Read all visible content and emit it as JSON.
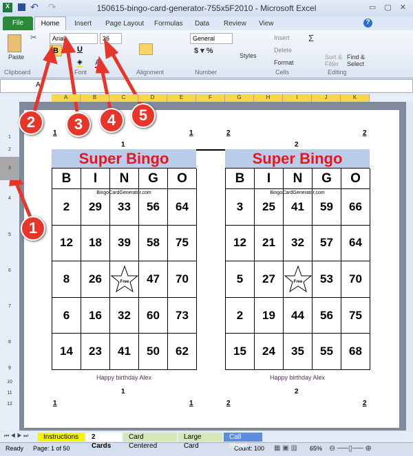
{
  "window": {
    "title": "150615-bingo-card-generator-755x5F2010 - Microsoft Excel"
  },
  "ribbon_tabs": [
    "File",
    "Home",
    "Insert",
    "Page Layout",
    "Formulas",
    "Data",
    "Review",
    "View"
  ],
  "ribbon": {
    "paste": "Paste",
    "font_name": "Arial",
    "font_size": "36",
    "bold": "B",
    "underline": "U",
    "number_format": "General",
    "styles": "Styles",
    "insert": "Insert",
    "delete": "Delete",
    "format": "Format",
    "sort_filter": "Sort & Filter",
    "find_select": "Find & Select",
    "groups": [
      "Clipboard",
      "Font",
      "Alignment",
      "Number",
      "Cells",
      "Editing"
    ]
  },
  "formula_bar": {
    "name_box": "A",
    "value": ""
  },
  "columns": [
    "A",
    "B",
    "C",
    "D",
    "E",
    "F",
    "G",
    "H",
    "I",
    "J",
    "K"
  ],
  "rows": [
    "1",
    "2",
    "3",
    "4",
    "5",
    "6",
    "7",
    "8",
    "9",
    "10",
    "11",
    "12"
  ],
  "cards": [
    {
      "corner": "1",
      "index": "1",
      "title": "Super Bingo",
      "letters": [
        "B",
        "I",
        "N",
        "G",
        "O"
      ],
      "site": "BingoCardGenerator.com",
      "free": "Free",
      "numbers": [
        [
          "2",
          "29",
          "33",
          "56",
          "64"
        ],
        [
          "12",
          "18",
          "39",
          "58",
          "75"
        ],
        [
          "8",
          "26",
          "",
          "47",
          "70"
        ],
        [
          "6",
          "16",
          "32",
          "60",
          "73"
        ],
        [
          "14",
          "23",
          "41",
          "50",
          "62"
        ]
      ],
      "footer": "Happy birthday Alex"
    },
    {
      "corner": "2",
      "index": "2",
      "title": "Super Bingo",
      "letters": [
        "B",
        "I",
        "N",
        "G",
        "O"
      ],
      "site": "BingoCardGenerator.com",
      "free": "Free",
      "numbers": [
        [
          "3",
          "25",
          "41",
          "59",
          "66"
        ],
        [
          "12",
          "21",
          "32",
          "57",
          "64"
        ],
        [
          "5",
          "27",
          "",
          "53",
          "70"
        ],
        [
          "2",
          "19",
          "44",
          "56",
          "75"
        ],
        [
          "15",
          "24",
          "35",
          "55",
          "68"
        ]
      ],
      "footer": "Happy birthday Alex"
    }
  ],
  "callouts": [
    "1",
    "2",
    "3",
    "4",
    "5"
  ],
  "sheet_tabs": [
    {
      "label": "Instructions",
      "color": "#f5f500"
    },
    {
      "label": "2 Cards",
      "color": "#ffffff"
    },
    {
      "label": "Card Centered",
      "color": "#d6e8b8"
    },
    {
      "label": "Large Card",
      "color": "#d6e8b8"
    },
    {
      "label": "Call Sheet",
      "color": "#5b8ede"
    }
  ],
  "status": {
    "ready": "Ready",
    "page": "Page: 1 of 50",
    "count": "Count: 100",
    "zoom": "65%"
  }
}
